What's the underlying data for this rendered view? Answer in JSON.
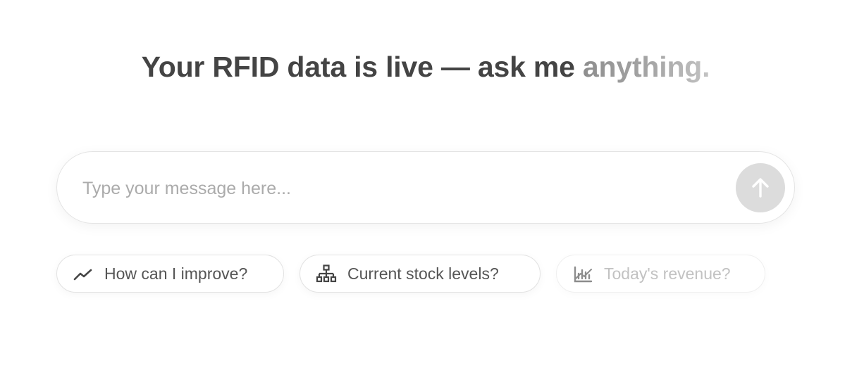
{
  "headline": {
    "main": "Your RFID data is live — ask me ",
    "emphasis": "anything."
  },
  "composer": {
    "placeholder": "Type your message here...",
    "send_icon": "arrow-up-icon"
  },
  "suggestions": [
    {
      "label": "How can I improve?",
      "icon": "trend-line-icon"
    },
    {
      "label": "Current stock levels?",
      "icon": "hierarchy-icon"
    },
    {
      "label": "Today's revenue?",
      "icon": "chart-trend-icon"
    }
  ],
  "colors": {
    "headline": "#444444",
    "send_button": "#dcdcdc",
    "chip_text": "#555555",
    "placeholder": "#ababab"
  }
}
